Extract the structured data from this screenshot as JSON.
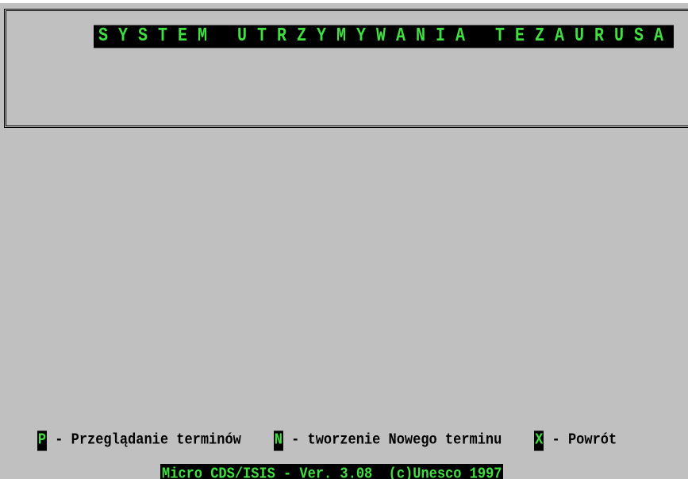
{
  "header": {
    "title": "SYSTEM UTRZYMYWANIA TEZAURUSA"
  },
  "menu": {
    "items": [
      {
        "key": "P",
        "separator": " - ",
        "label": "Przeglądanie terminów"
      },
      {
        "key": "N",
        "separator": " - ",
        "label": "tworzenie Nowego terminu"
      },
      {
        "key": "X",
        "separator": " - ",
        "label": "Powrót"
      }
    ]
  },
  "status_bar": {
    "text": "Micro CDS/ISIS - Ver. 3.08  (c)Unesco 1997"
  },
  "colors": {
    "background": "#c0c0c0",
    "highlight_bg": "#000000",
    "highlight_fg": "#3fe03f",
    "text": "#000000"
  }
}
